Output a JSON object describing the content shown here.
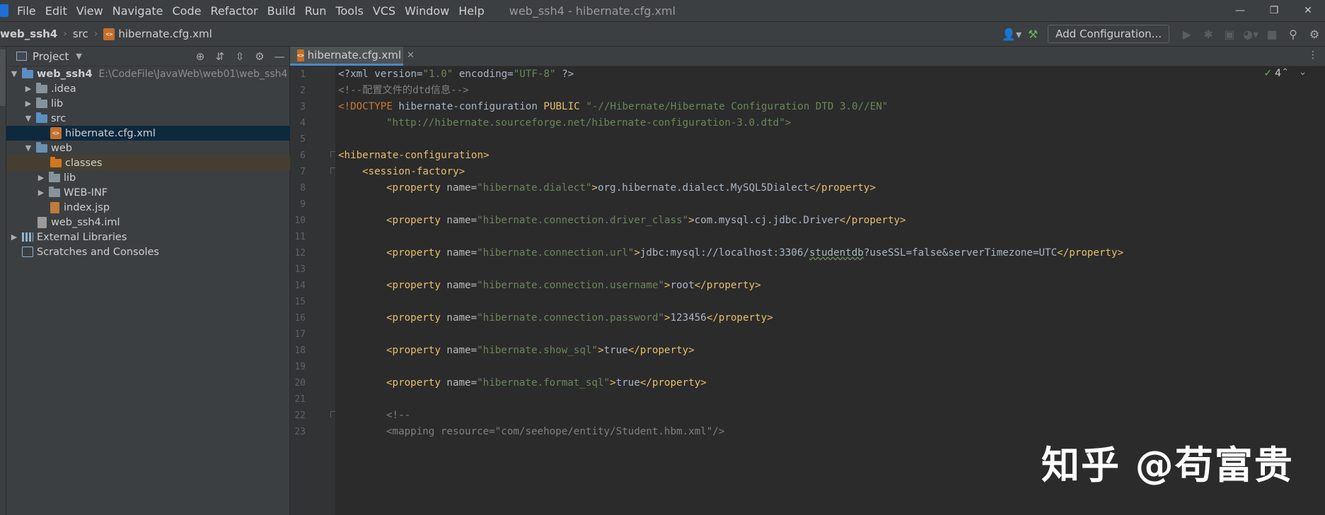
{
  "menu": {
    "items": [
      "File",
      "Edit",
      "View",
      "Navigate",
      "Code",
      "Refactor",
      "Build",
      "Run",
      "Tools",
      "VCS",
      "Window",
      "Help"
    ],
    "window_title": "web_ssh4 - hibernate.cfg.xml"
  },
  "navbar": {
    "crumb_project": "web_ssh4",
    "crumb_src": "src",
    "crumb_file": "hibernate.cfg.xml",
    "add_config_label": "Add Configuration..."
  },
  "project_panel": {
    "title": "Project",
    "tree": {
      "root": "web_ssh4",
      "root_path": "E:\\CodeFile\\JavaWeb\\web01\\web_ssh4",
      "idea": ".idea",
      "lib": "lib",
      "src": "src",
      "cfg": "hibernate.cfg.xml",
      "web": "web",
      "classes": "classes",
      "web_lib": "lib",
      "webinf": "WEB-INF",
      "index": "index.jsp",
      "iml": "web_ssh4.iml",
      "ext_libs": "External Libraries",
      "scratches": "Scratches and Consoles"
    }
  },
  "editor": {
    "tab_label": "hibernate.cfg.xml",
    "inspection_count": "4",
    "line_numbers": [
      "1",
      "2",
      "3",
      "4",
      "5",
      "6",
      "7",
      "8",
      "9",
      "10",
      "11",
      "12",
      "13",
      "14",
      "15",
      "16",
      "17",
      "18",
      "19",
      "20",
      "21",
      "22",
      "23"
    ],
    "code": {
      "l1_decl": "<?xml version=",
      "l1_v1": "\"1.0\"",
      "l1_enc": " encoding=",
      "l1_v2": "\"UTF-8\"",
      "l1_end": " ?>",
      "l2_comment": "<!--配置文件的dtd信息-->",
      "l3_doctype": "<!DOCTYPE",
      "l3_name": " hibernate-configuration ",
      "l3_public": "PUBLIC",
      "l3_str": " \"-//Hibernate/Hibernate Configuration DTD 3.0//EN\"",
      "l4_str": "\"http://hibernate.sourceforge.net/hibernate-configuration-3.0.dtd\">",
      "l6_tag": "<hibernate-configuration>",
      "l7_tag": "<session-factory>",
      "prop_open": "<property",
      "name_attr": " name=",
      "prop_close": "</property>",
      "gt": ">",
      "l8_name": "\"hibernate.dialect\"",
      "l8_val": "org.hibernate.dialect.MySQL5Dialect",
      "l10_name": "\"hibernate.connection.driver_class\"",
      "l10_val": "com.mysql.cj.jdbc.Driver",
      "l12_name": "\"hibernate.connection.url\"",
      "l12_val_a": "jdbc:mysql://localhost:3306/",
      "l12_val_b": "studentdb",
      "l12_val_c": "?useSSL=false&serverTimezone=UTC",
      "l14_name": "\"hibernate.connection.username\"",
      "l14_val": "root",
      "l16_name": "\"hibernate.connection.password\"",
      "l16_val": "123456",
      "l18_name": "\"hibernate.show_sql\"",
      "l18_val": "true",
      "l20_name": "\"hibernate.format_sql\"",
      "l20_val": "true",
      "l22_comment": "<!--",
      "l23_open": "<mapping",
      "l23_attr": " resource=",
      "l23_val": "\"com/seehope/entity/Student.hbm.xml\"",
      "l23_end": "/>"
    }
  },
  "watermark": "知乎 @苟富贵",
  "colors": {
    "background": "#2b2b2b",
    "tag": "#e8bf6a",
    "string": "#6a8759",
    "comment": "#808080",
    "keyword": "#cc7832",
    "selection": "#0d293e"
  },
  "icons": [
    "app-icon",
    "folder-icon",
    "xml-file-icon",
    "jsp-file-icon",
    "gear-icon",
    "search-icon",
    "hammer-icon",
    "run-icon",
    "debug-icon",
    "stop-icon",
    "user-icon",
    "close-icon"
  ]
}
